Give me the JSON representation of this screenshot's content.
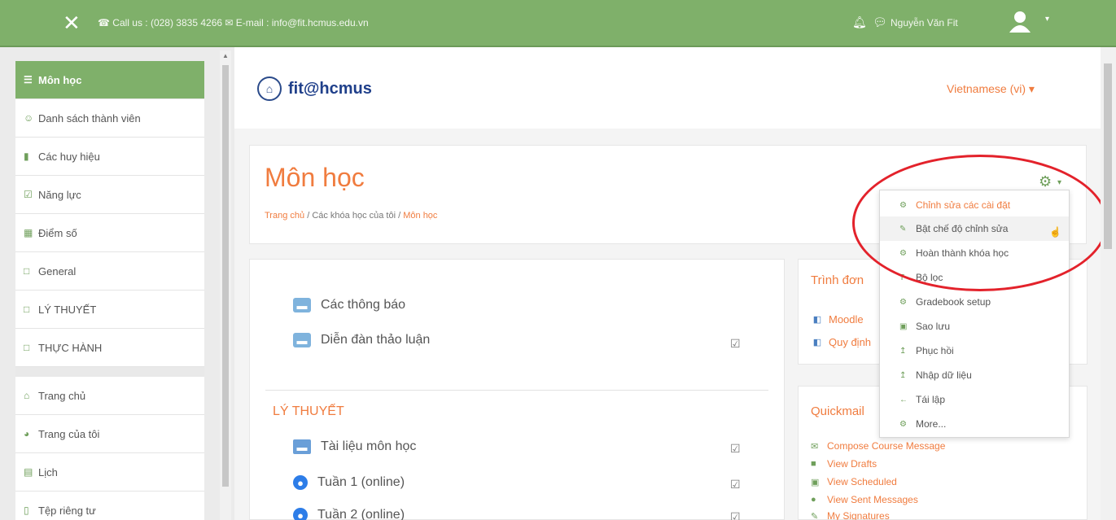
{
  "topbar": {
    "contact": "☎ Call us : (028) 3835 4266 ✉ E-mail : info@fit.hcmus.edu.vn",
    "username": "Nguyễn Văn Fit"
  },
  "sidebar": {
    "items": [
      {
        "label": "Môn học",
        "icon": "☰"
      },
      {
        "label": "Danh sách thành viên",
        "icon": "☺"
      },
      {
        "label": "Các huy hiệu",
        "icon": "▮"
      },
      {
        "label": "Năng lực",
        "icon": "☑"
      },
      {
        "label": "Điểm số",
        "icon": "▦"
      },
      {
        "label": "General",
        "icon": "□"
      },
      {
        "label": "LÝ THUYẾT",
        "icon": "□"
      },
      {
        "label": "THỰC HÀNH",
        "icon": "□"
      },
      {
        "label": "Trang chủ",
        "icon": "⌂"
      },
      {
        "label": "Trang của tôi",
        "icon": "◕"
      },
      {
        "label": "Lịch",
        "icon": "▤"
      },
      {
        "label": "Tệp riêng tư",
        "icon": "▯"
      }
    ]
  },
  "header": {
    "logo_text": "fit@hcmus",
    "language": "Vietnamese (vi) ▾",
    "page_title": "Môn học",
    "breadcrumb": [
      "Trang chủ",
      "Các khóa học của tôi",
      "Môn học"
    ],
    "breadcrumb_sep": "/"
  },
  "content": {
    "activities": [
      {
        "label": "Các thông báo",
        "type": "forum"
      },
      {
        "label": "Diễn đàn thảo luận",
        "type": "forum"
      }
    ],
    "section_title": "LÝ THUYẾT",
    "section_activities": [
      {
        "label": "Tài liệu môn học",
        "type": "folder"
      },
      {
        "label": "Tuần 1 (online)",
        "type": "zoom"
      },
      {
        "label": "Tuần 2 (online)",
        "type": "zoom"
      }
    ]
  },
  "blocks": {
    "menu_title": "Trình đơn",
    "menu_links": [
      "Moodle",
      "Quy định"
    ],
    "quickmail_title": "Quickmail",
    "quickmail_links": [
      "Compose Course Message",
      "View Drafts",
      "View Scheduled",
      "View Sent Messages",
      "My Signatures"
    ]
  },
  "dropdown": {
    "items": [
      {
        "label": "Chỉnh sửa các cài đặt",
        "icon": "⚙"
      },
      {
        "label": "Bật chế độ chỉnh sửa",
        "icon": "✎"
      },
      {
        "label": "Hoàn thành khóa học",
        "icon": "⚙"
      },
      {
        "label": "Bộ lọc",
        "icon": "T"
      },
      {
        "label": "Gradebook setup",
        "icon": "⚙"
      },
      {
        "label": "Sao lưu",
        "icon": "▣"
      },
      {
        "label": "Phục hồi",
        "icon": "↥"
      },
      {
        "label": "Nhập dữ liệu",
        "icon": "↥"
      },
      {
        "label": "Tái lập",
        "icon": "←"
      },
      {
        "label": "More...",
        "icon": "⚙"
      }
    ]
  },
  "colors": {
    "brand_green": "#7fb06a",
    "accent_orange": "#f07c3f",
    "highlight_red": "#e3222b"
  }
}
